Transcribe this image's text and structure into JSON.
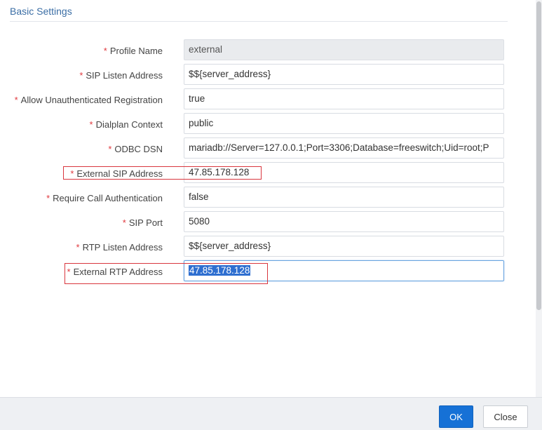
{
  "section": {
    "title": "Basic Settings"
  },
  "required_marker": "*",
  "fields": [
    {
      "label": "Profile Name",
      "value": "external"
    },
    {
      "label": "SIP Listen Address",
      "value": "$${server_address}"
    },
    {
      "label": "Allow Unauthenticated Registration",
      "value": "true"
    },
    {
      "label": "Dialplan Context",
      "value": "public"
    },
    {
      "label": "ODBC DSN",
      "value": "mariadb://Server=127.0.0.1;Port=3306;Database=freeswitch;Uid=root;P"
    },
    {
      "label": "External SIP Address",
      "value": "47.85.178.128"
    },
    {
      "label": "Require Call Authentication",
      "value": "false"
    },
    {
      "label": "SIP Port",
      "value": "5080"
    },
    {
      "label": "RTP Listen Address",
      "value": "$${server_address}"
    },
    {
      "label": "External RTP Address",
      "value": "47.85.178.128"
    }
  ],
  "footer": {
    "ok_label": "OK",
    "close_label": "Close"
  },
  "colors": {
    "primary": "#1671d6",
    "required": "#e0393e",
    "annotation": "#d9363e",
    "title": "#3b6ea5"
  }
}
